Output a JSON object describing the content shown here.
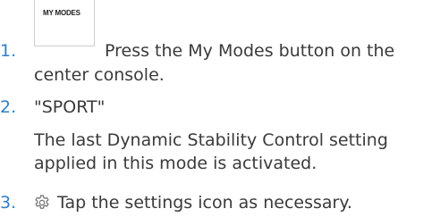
{
  "steps": [
    {
      "number": "1.",
      "button_icon_label": "MY MODES",
      "text_line1": "Press the My Modes button on the",
      "text_line2": "center console."
    },
    {
      "number": "2.",
      "text": "\"SPORT\"",
      "note_line1": "The last Dynamic Stability Control setting",
      "note_line2": "applied in this mode is activated."
    },
    {
      "number": "3.",
      "icon": "gear-icon",
      "text": "Tap the settings icon as necessary."
    }
  ],
  "colors": {
    "accent": "#2f7fc8",
    "text": "#3a3a3a",
    "icon": "#7a7a7a"
  }
}
